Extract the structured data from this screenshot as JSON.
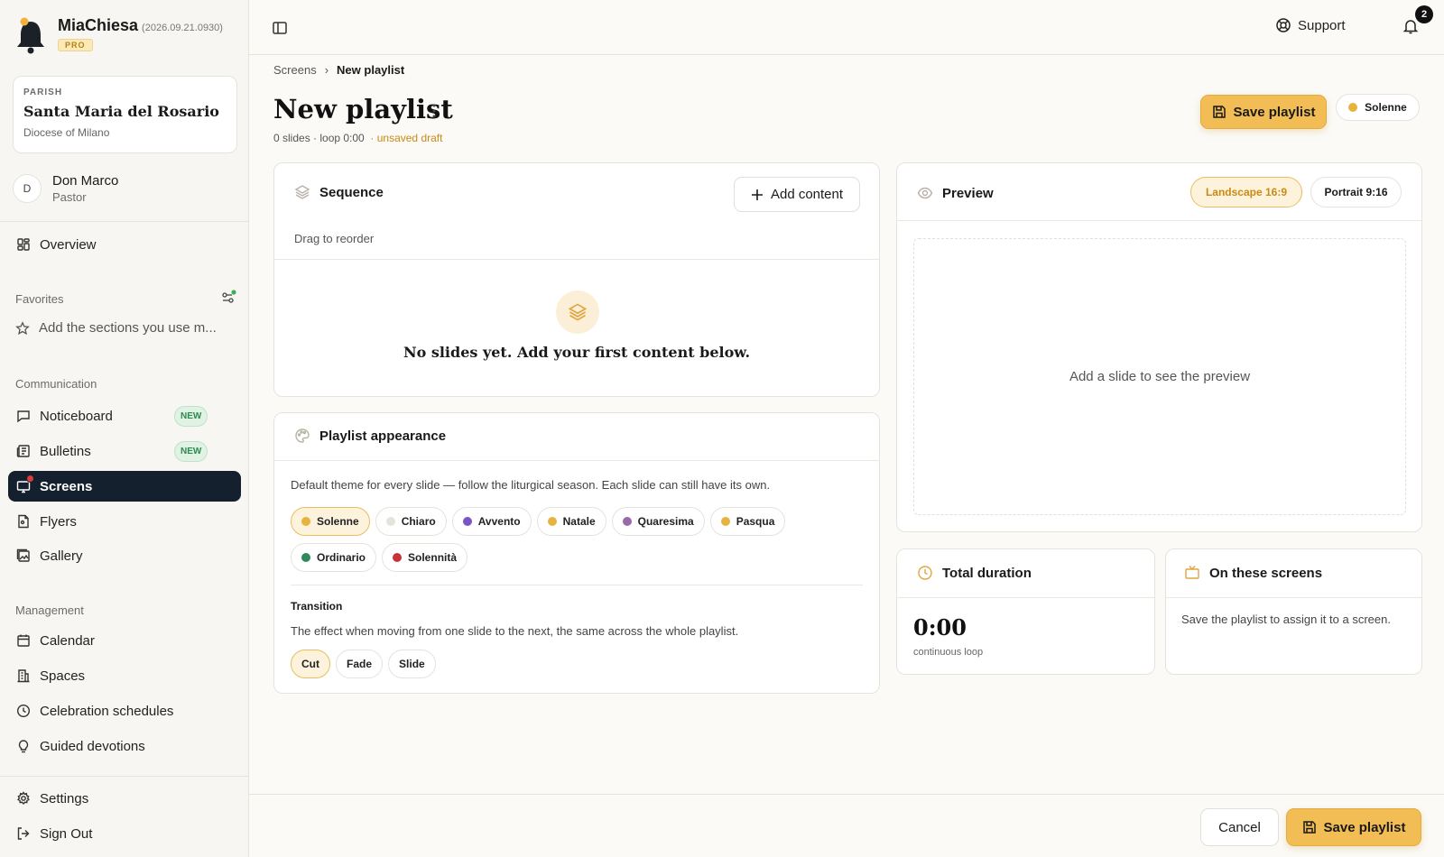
{
  "brand": {
    "name": "MiaChiesa",
    "version": "(2026.09.21.0930)",
    "badge": "PRO"
  },
  "parish": {
    "label": "PARISH",
    "name": "Santa Maria del Rosario",
    "diocese": "Diocese of Milano"
  },
  "user": {
    "initial": "D",
    "name": "Don Marco",
    "role": "Pastor"
  },
  "nav": {
    "overview": "Overview",
    "favorites_label": "Favorites",
    "favorites_hint": "Add the sections you use m...",
    "communication_label": "Communication",
    "noticeboard": "Noticeboard",
    "bulletins": "Bulletins",
    "new_badge": "NEW",
    "screens": "Screens",
    "flyers": "Flyers",
    "gallery": "Gallery",
    "management_label": "Management",
    "calendar": "Calendar",
    "spaces": "Spaces",
    "celebration": "Celebration schedules",
    "devotions": "Guided devotions",
    "settings": "Settings",
    "signout": "Sign Out"
  },
  "topbar": {
    "support": "Support",
    "notifications": "2"
  },
  "breadcrumb": {
    "parent": "Screens",
    "sep": "›",
    "current": "New playlist"
  },
  "page": {
    "title": "New playlist",
    "meta": "0 slides · loop 0:00",
    "draft": "· unsaved draft"
  },
  "actions": {
    "save": "Save playlist",
    "cancel": "Cancel",
    "theme": "Solenne"
  },
  "sequence": {
    "title": "Sequence",
    "add": "Add content",
    "hint": "Drag to reorder",
    "empty": "No slides yet. Add your first content below."
  },
  "appearance": {
    "title": "Playlist appearance",
    "desc": "Default theme for every slide — follow the liturgical season. Each slide can still have its own.",
    "themes": [
      {
        "label": "Solenne",
        "color": "#e7b33f"
      },
      {
        "label": "Chiaro",
        "color": "#e6e3dc"
      },
      {
        "label": "Avvento",
        "color": "#7b55c7"
      },
      {
        "label": "Natale",
        "color": "#e7b33f"
      },
      {
        "label": "Quaresima",
        "color": "#9a6aa8"
      },
      {
        "label": "Pasqua",
        "color": "#e7b33f"
      },
      {
        "label": "Ordinario",
        "color": "#2e8a5e"
      },
      {
        "label": "Solennità",
        "color": "#c8323a"
      }
    ],
    "transition_title": "Transition",
    "transition_desc": "The effect when moving from one slide to the next, the same across the whole playlist.",
    "transitions": [
      "Cut",
      "Fade",
      "Slide"
    ]
  },
  "preview": {
    "title": "Preview",
    "landscape": "Landscape 16:9",
    "portrait": "Portrait 9:16",
    "empty": "Add a slide to see the preview"
  },
  "duration": {
    "title": "Total duration",
    "value": "0:00",
    "caption": "continuous loop"
  },
  "screens": {
    "title": "On these screens",
    "desc": "Save the playlist to assign it to a screen."
  }
}
